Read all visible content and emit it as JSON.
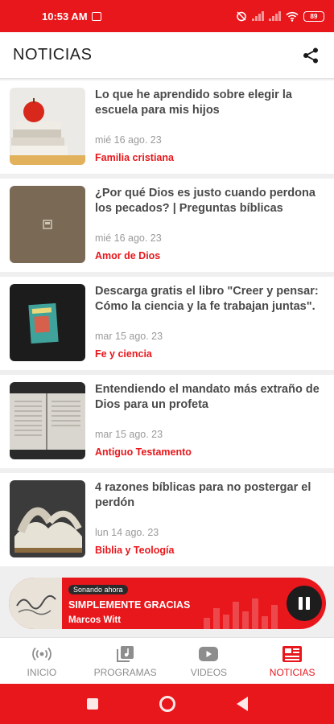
{
  "status": {
    "time": "10:53 AM",
    "battery": "89"
  },
  "header": {
    "title": "NOTICIAS",
    "share_icon": "share-icon"
  },
  "articles": [
    {
      "title": "Lo que he aprendido sobre elegir la escuela para mis hijos",
      "date": "mié 16 ago. 23",
      "category": "Familia cristiana"
    },
    {
      "title": "¿Por qué Dios es justo cuando perdona los pecados? | Preguntas bíblicas",
      "date": "mié 16 ago. 23",
      "category": "Amor de Dios"
    },
    {
      "title": "Descarga gratis el libro \"Creer y pensar: Cómo la ciencia y la fe trabajan juntas\".",
      "date": "mar 15 ago. 23",
      "category": "Fe y ciencia"
    },
    {
      "title": "Entendiendo el mandato más extraño de Dios para un profeta",
      "date": "mar 15 ago. 23",
      "category": "Antiguo Testamento"
    },
    {
      "title": "4 razones bíblicas para no postergar el perdón",
      "date": "lun 14 ago. 23",
      "category": "Biblia y Teología"
    }
  ],
  "player": {
    "badge": "Sonando ahora",
    "song": "SIMPLEMENTE GRACIAS",
    "artist": "Marcos Witt"
  },
  "tabs": [
    {
      "label": "INICIO",
      "icon": "radio-icon"
    },
    {
      "label": "PROGRAMAS",
      "icon": "playlist-icon"
    },
    {
      "label": "VIDEOS",
      "icon": "youtube-icon"
    },
    {
      "label": "NOTICIAS",
      "icon": "news-icon"
    }
  ],
  "colors": {
    "accent": "#e8171c"
  }
}
